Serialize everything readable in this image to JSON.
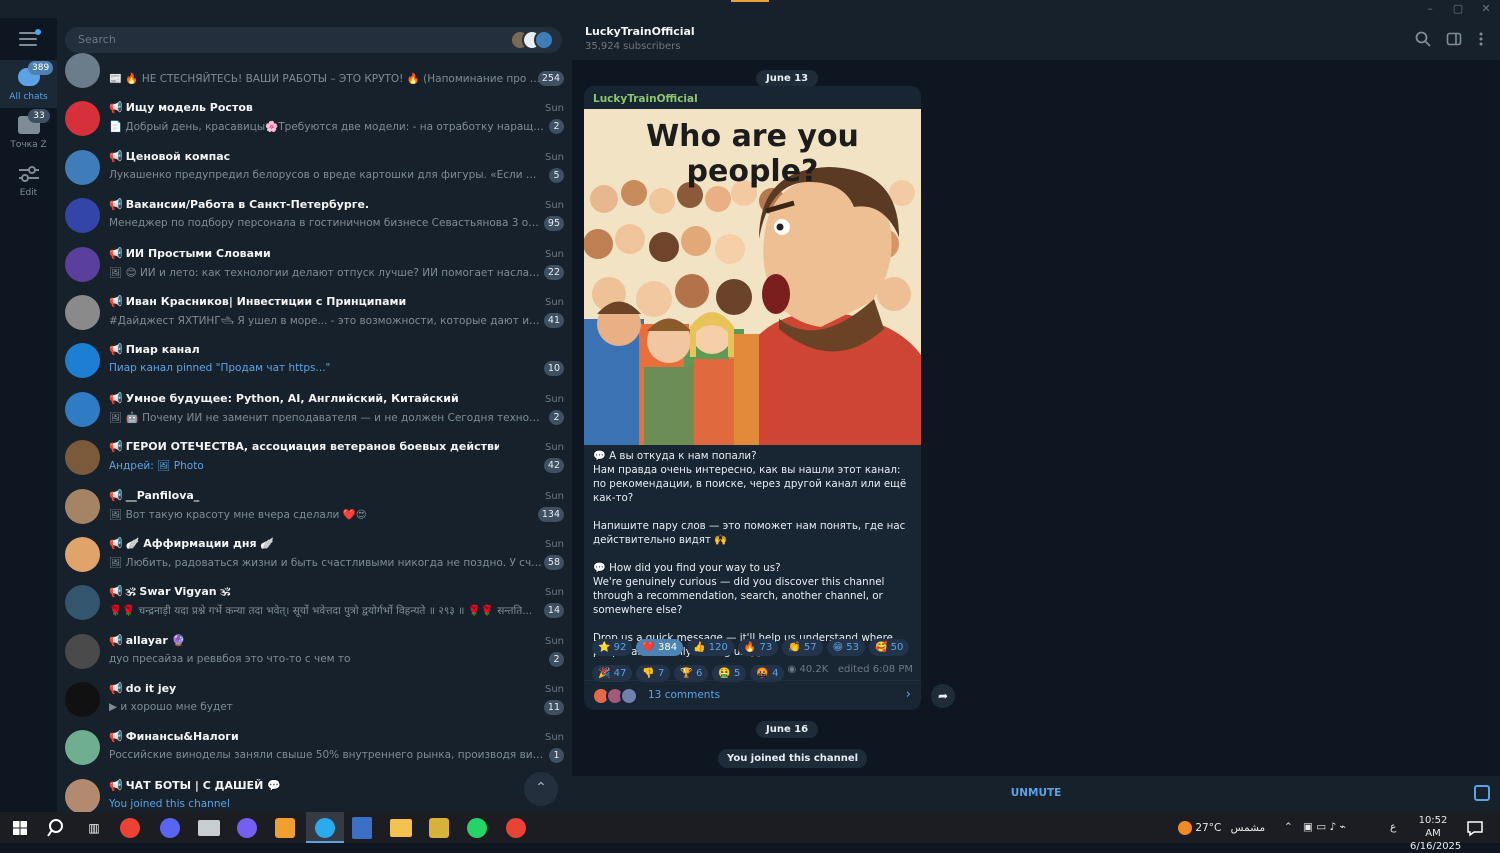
{
  "window": {
    "minimize": "–",
    "maximize": "▢",
    "close": "✕"
  },
  "rail": {
    "folders": [
      {
        "label": "All chats",
        "badge": "389"
      },
      {
        "label": "Точка Z",
        "badge": "33"
      },
      {
        "label": "Edit"
      }
    ]
  },
  "search": {
    "placeholder": "Search"
  },
  "chats": [
    {
      "name": "",
      "time": "",
      "preview": "📰 🔥 НЕ СТЕСНЯЙТЕСЬ! ВАШИ РАБОТЫ – ЭТО КРУТО! 🔥 (Напоминание про конкурс...",
      "badge": "254",
      "color": "#6b7d8a"
    },
    {
      "name": "Ищу модель Ростов",
      "time": "Sun",
      "preview": "📄 Добрый день, красавицы🌸Требуются две модели: - на отработку наращивания ре...",
      "badge": "2",
      "color": "#d6303a"
    },
    {
      "name": "Ценовой компас",
      "time": "Sun",
      "preview": "Лукашенко предупредил белорусов о вреде картошки для фигуры. «Если мы будем ес...",
      "badge": "5",
      "color": "#3f7db8"
    },
    {
      "name": "Вакансии/Работа в Санкт-Петербурге.",
      "time": "Sun",
      "preview": "Менеджер по подбору персонала в гостиничном бизнесе Севастьянова 3 от 70 000 руб...",
      "badge": "95",
      "color": "#3346a8"
    },
    {
      "name": "ИИ Простыми Словами",
      "time": "Sun",
      "preview": "🖼 😊 ИИ и лето: как технологии делают отпуск лучше? ИИ помогает наслаждаться л...",
      "badge": "22",
      "color": "#5a3f9e"
    },
    {
      "name": "Иван Красников| Инвестиции с Принципами",
      "time": "Sun",
      "preview": "#Дайджест ЯХТИНГ🛥 Я ушел в море... - это возможности, которые дают инвестици...",
      "badge": "41",
      "color": "#8a8a8a"
    },
    {
      "name": "Пиар канал",
      "time": "",
      "preview": "Пиар канал pinned \"Продам чат https...\"",
      "badge": "10",
      "color": "#1d7fd1",
      "blue": true
    },
    {
      "name": "Умное будущее: Python, AI, Английский, Китайский",
      "time": "Sun",
      "preview": "🖼 🤖 Почему ИИ не заменит преподавателя — и не должен Сегодня технологии позв...",
      "badge": "2",
      "color": "#2f7bc4"
    },
    {
      "name": "ГЕРОИ ОТЕЧЕСТВА, ассоциация ветеранов боевых действий",
      "time": "Sun",
      "preview": "Андрей: 🖼 Photo",
      "badge": "42",
      "color": "#7a5a3a",
      "blue": true
    },
    {
      "name": "__Panfilova_",
      "time": "Sun",
      "preview": "🖼 Вот такую красоту мне вчера сделали ❤️😍",
      "badge": "134",
      "color": "#a58466"
    },
    {
      "name": "🪽 Аффирмации дня 🪽",
      "time": "Sun",
      "preview": "🖼 Любить, радоваться жизни и быть счастливыми никогда не поздно. У счастья нет с...",
      "badge": "58",
      "color": "#e0a46a"
    },
    {
      "name": "🕉 Swar Vigyan 🕉",
      "time": "Sun",
      "preview": "🌹🌹 चन्द्रनाड़ी यदा प्रश्ने गर्भे कन्या तदा भवेत्। सूर्यो भवेत्तदा पुत्रो द्वयोर्गर्भो विहन्यते ॥ २९३ ॥ 🌹🌹 सन्तति...",
      "badge": "14",
      "color": "#34556e"
    },
    {
      "name": "allayar 🔮",
      "time": "Sun",
      "preview": "дуо пресайза и реввбоя это что-то с чем то",
      "badge": "2",
      "color": "#4a4a4a"
    },
    {
      "name": "do it jey",
      "time": "Sun",
      "preview": "▶ и хорошо мне будет",
      "badge": "11",
      "color": "#111111"
    },
    {
      "name": "Финансы&Налоги",
      "time": "Sun",
      "preview": "Российские виноделы заняли свыше 50% внутреннего рынка, производя вино, не уступ...",
      "badge": "1",
      "color": "#6fae8f"
    },
    {
      "name": "ЧАТ БОТЫ | С ДАШЕЙ 💬",
      "time": "",
      "preview": "You joined this channel",
      "badge": "",
      "color": "#b28a70",
      "blue": true
    }
  ],
  "scrolltop": "⌃",
  "header": {
    "title": "LuckyTrainOfficial",
    "subtitle": "35,924 subscribers"
  },
  "dates": {
    "first": "June 13",
    "second": "June 16"
  },
  "post": {
    "author": "LuckyTrainOfficial",
    "image_heading": "Who are you people?",
    "paragraphs": [
      "💬 А вы откуда к нам попали?\nНам правда очень интересно, как вы нашли этот канал: по рекомендации, в поиске, через другой канал или ещё как-то?",
      "Напишите пару слов — это поможет нам понять, где нас действительно видят 🙌",
      "💬 How did you find your way to us?\nWe're genuinely curious — did you discover this channel through a recommendation, search, another channel, or somewhere else?",
      "Drop us a quick message — it'll help us understand where people are actually finding us 🙌"
    ],
    "reactions": [
      {
        "emoji": "⭐",
        "count": "92"
      },
      {
        "emoji": "❤️",
        "count": "384",
        "me": true
      },
      {
        "emoji": "👍",
        "count": "120"
      },
      {
        "emoji": "🔥",
        "count": "73"
      },
      {
        "emoji": "👏",
        "count": "57"
      },
      {
        "emoji": "😁",
        "count": "53"
      },
      {
        "emoji": "🥰",
        "count": "50"
      },
      {
        "emoji": "🎉",
        "count": "47"
      },
      {
        "emoji": "👎",
        "count": "7"
      },
      {
        "emoji": "🏆",
        "count": "6"
      },
      {
        "emoji": "🤮",
        "count": "5"
      },
      {
        "emoji": "🤬",
        "count": "4"
      }
    ],
    "views": "40.2K",
    "edited": "edited 6:08 PM",
    "comments": "13 comments"
  },
  "joined": "You joined this channel",
  "bottom": {
    "unmute": "UNMUTE"
  },
  "taskbar": {
    "weather": "27°C",
    "weather_desc": "مشمس",
    "lang": "ع",
    "time": "10:52 AM",
    "date": "6/16/2025"
  }
}
